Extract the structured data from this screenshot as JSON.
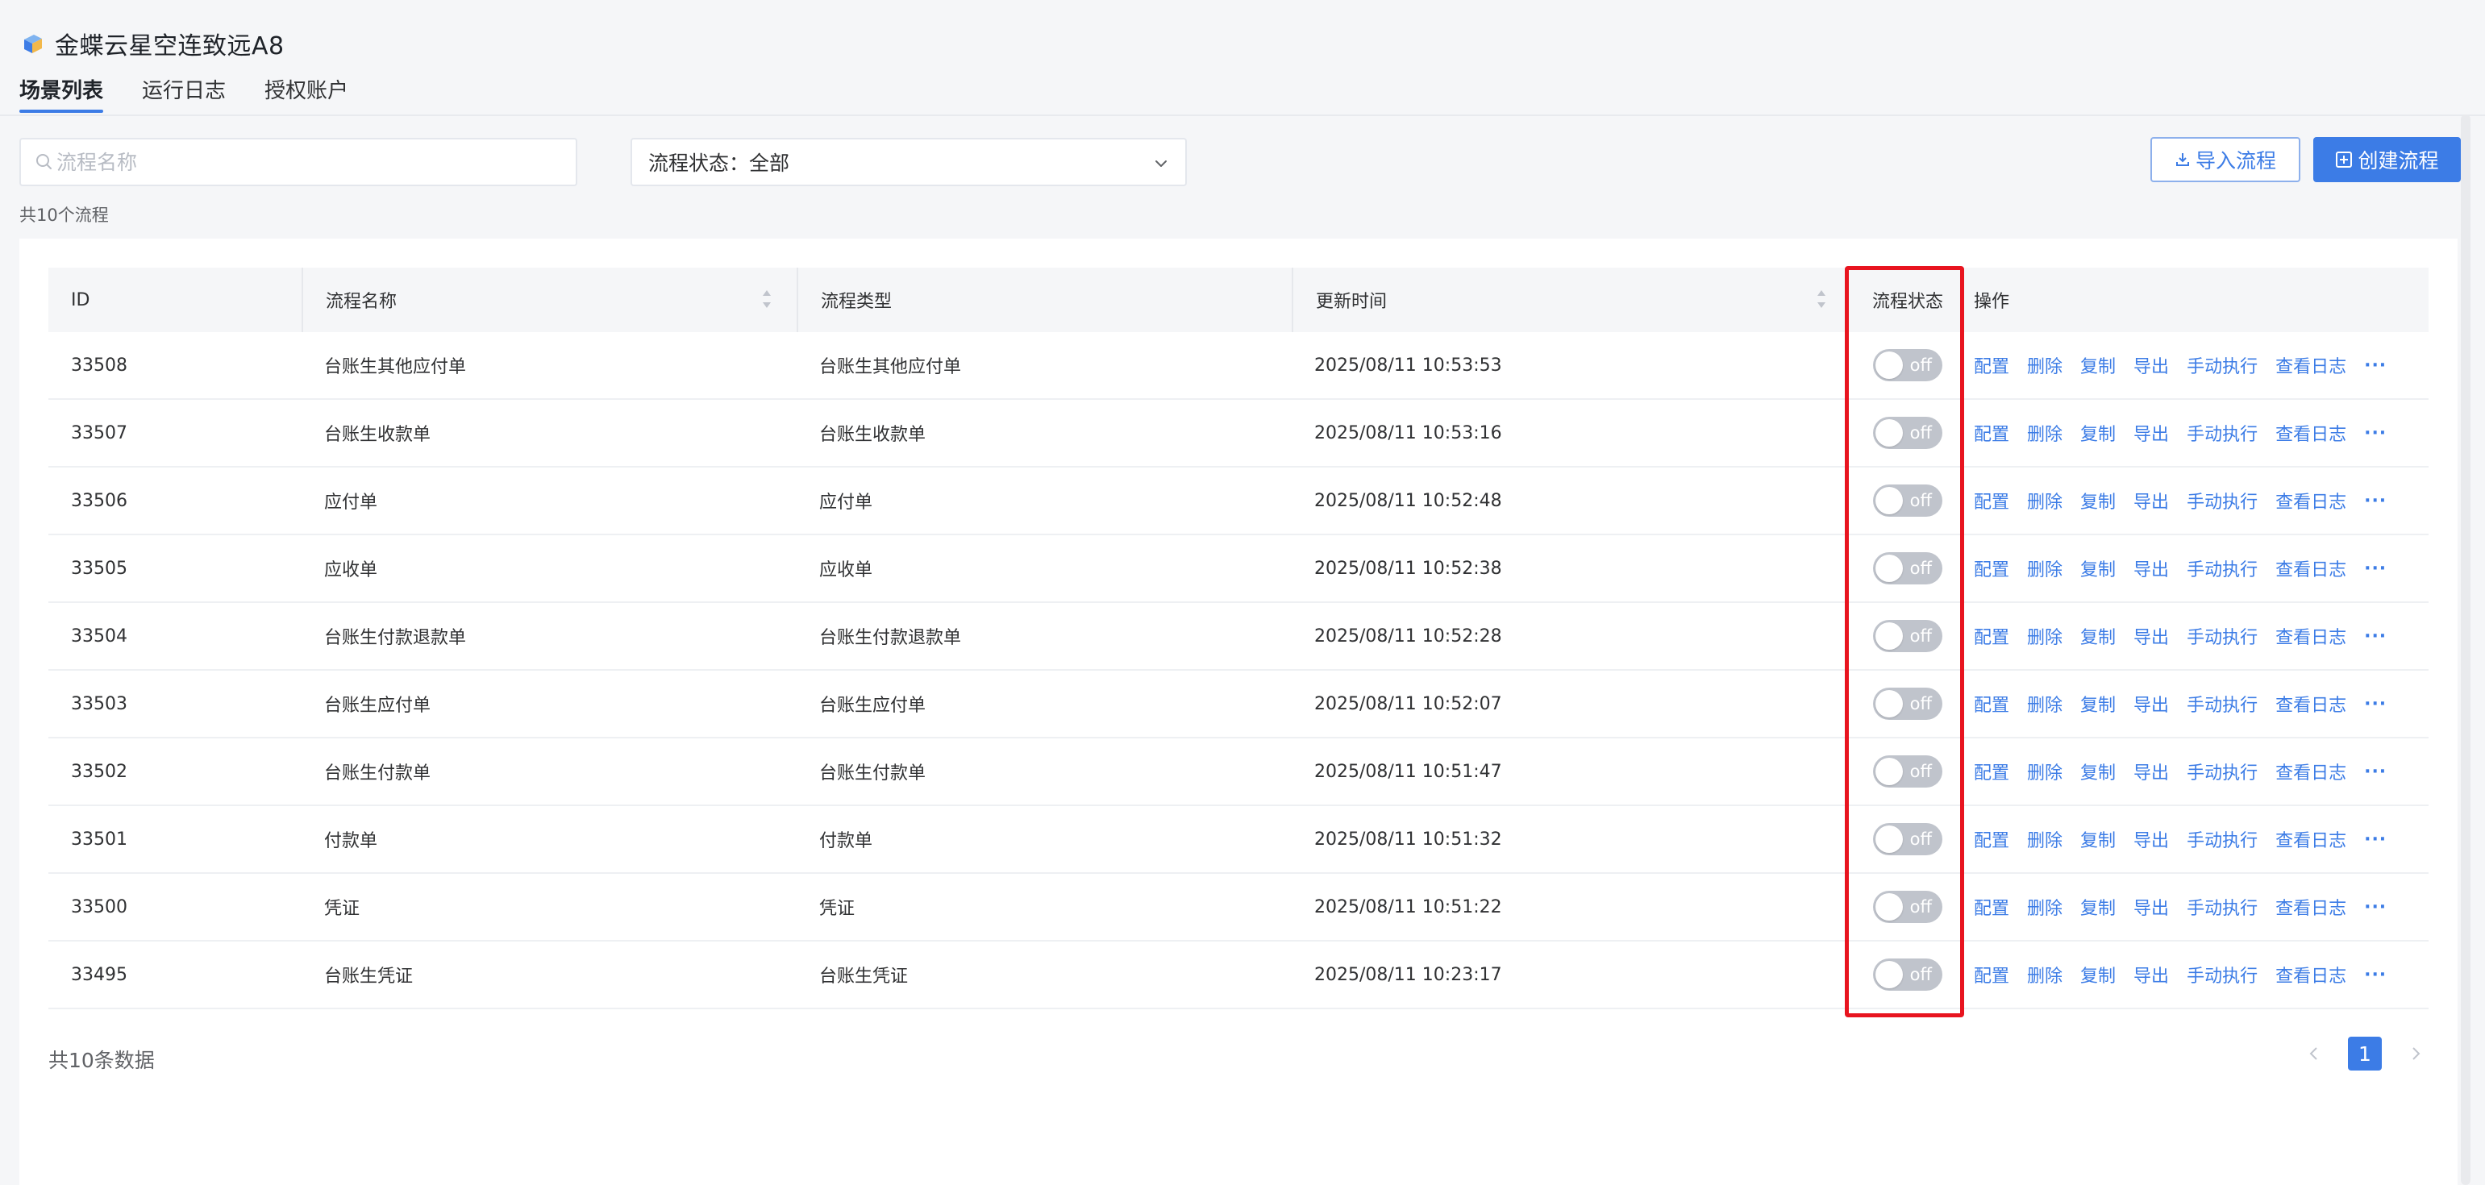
{
  "app": {
    "title": "金蝶云星空连致远A8"
  },
  "tabs": [
    {
      "label": "场景列表",
      "active": true
    },
    {
      "label": "运行日志",
      "active": false
    },
    {
      "label": "授权账户",
      "active": false
    }
  ],
  "filter": {
    "search_placeholder": "流程名称",
    "status_label": "流程状态：全部",
    "import_label": "导入流程",
    "create_label": "创建流程"
  },
  "total_text": "共10个流程",
  "table": {
    "headers": {
      "id": "ID",
      "name": "流程名称",
      "type": "流程类型",
      "time": "更新时间",
      "status": "流程状态",
      "ops": "操作"
    },
    "rows": [
      {
        "id": "33508",
        "name": "台账生其他应付单",
        "type": "台账生其他应付单",
        "time": "2025/08/11 10:53:53",
        "status": "off"
      },
      {
        "id": "33507",
        "name": "台账生收款单",
        "type": "台账生收款单",
        "time": "2025/08/11 10:53:16",
        "status": "off"
      },
      {
        "id": "33506",
        "name": "应付单",
        "type": "应付单",
        "time": "2025/08/11 10:52:48",
        "status": "off"
      },
      {
        "id": "33505",
        "name": "应收单",
        "type": "应收单",
        "time": "2025/08/11 10:52:38",
        "status": "off"
      },
      {
        "id": "33504",
        "name": "台账生付款退款单",
        "type": "台账生付款退款单",
        "time": "2025/08/11 10:52:28",
        "status": "off"
      },
      {
        "id": "33503",
        "name": "台账生应付单",
        "type": "台账生应付单",
        "time": "2025/08/11 10:52:07",
        "status": "off"
      },
      {
        "id": "33502",
        "name": "台账生付款单",
        "type": "台账生付款单",
        "time": "2025/08/11 10:51:47",
        "status": "off"
      },
      {
        "id": "33501",
        "name": "付款单",
        "type": "付款单",
        "time": "2025/08/11 10:51:32",
        "status": "off"
      },
      {
        "id": "33500",
        "name": "凭证",
        "type": "凭证",
        "time": "2025/08/11 10:51:22",
        "status": "off"
      },
      {
        "id": "33495",
        "name": "台账生凭证",
        "type": "台账生凭证",
        "time": "2025/08/11 10:23:17",
        "status": "off"
      }
    ],
    "row_actions": [
      "配置",
      "删除",
      "复制",
      "导出",
      "手动执行",
      "查看日志",
      "···"
    ]
  },
  "footer": {
    "total_text": "共10条数据",
    "current_page": "1"
  },
  "colors": {
    "accent": "#3c7ce6",
    "highlight": "#e8141f",
    "switch_off": "#c0c4cc"
  }
}
